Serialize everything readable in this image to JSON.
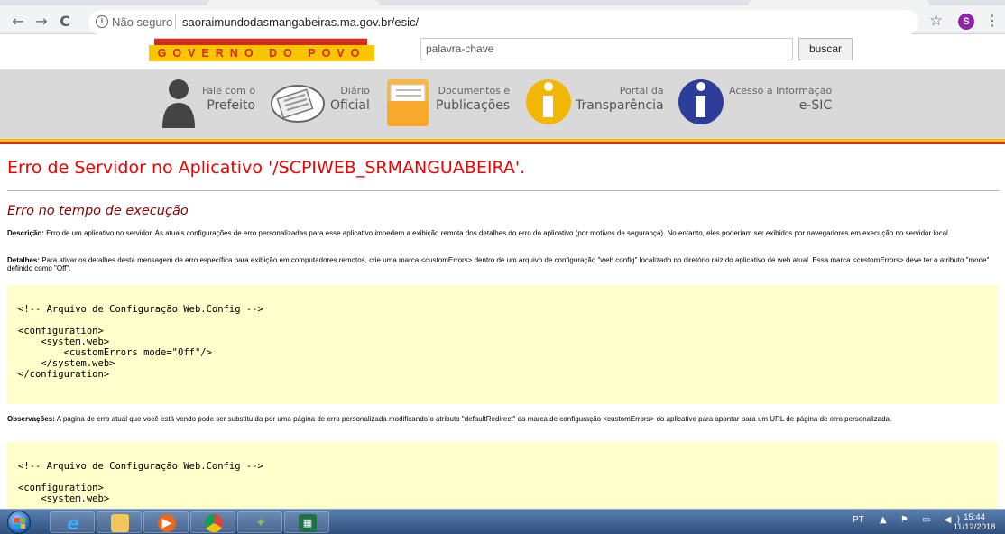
{
  "browser": {
    "back_icon": "←",
    "forward_icon": "→",
    "reload_icon": "C",
    "security_label": "Não seguro",
    "url": "saoraimundodasmangabeiras.ma.gov.br/esic/",
    "star_icon": "☆",
    "profile_initial": "S",
    "menu_icon": "⋮"
  },
  "header": {
    "logo_tagline": "GOVERNO DO POVO",
    "search_placeholder": "palavra-chave",
    "search_button": "buscar"
  },
  "nav": {
    "items": [
      {
        "line1": "Fale com o",
        "line2": "Prefeito",
        "icon": "person-icon"
      },
      {
        "line1": "Diário",
        "line2": "Oficial",
        "icon": "document-icon"
      },
      {
        "line1": "Documentos e",
        "line2": "Publicações",
        "icon": "folder-icon"
      },
      {
        "line1": "Portal da",
        "line2": "Transparência",
        "icon": "info-icon"
      },
      {
        "line1": "Acesso a Informação",
        "line2": "e-SIC",
        "icon": "info-icon"
      }
    ]
  },
  "error": {
    "title": "Erro de Servidor no Aplicativo '/SCPIWEB_SRMANGUABEIRA'.",
    "subtitle": "Erro no tempo de execução",
    "desc_label": "Descrição:",
    "desc_text": " Erro de um aplicativo no servidor. As atuais configurações de erro personalizadas para esse aplicativo impedem a exibição remota dos detalhes do erro do aplicativo (por motivos de segurança). No entanto, eles poderiam ser exibidos por navegadores em execução no servidor local.",
    "details_label": "Detalhes:",
    "details_text": " Para ativar os detalhes desta mensagem de erro específica para exibição em computadores remotos, crie uma marca <customErrors> dentro de um arquivo de configuração \"web.config\" localizado no diretório raiz do aplicativo de web atual. Essa marca <customErrors> deve ter o atributo \"mode\" definido como \"Off\".",
    "code1": "\n<!-- Arquivo de Configuração Web.Config -->\n\n<configuration>\n    <system.web>\n        <customErrors mode=\"Off\"/>\n    </system.web>\n</configuration>\n",
    "obs_label": "Observações:",
    "obs_text": " A página de erro atual que você está vendo pode ser substituída por uma página de erro personalizada modificando o atributo \"defaultRedirect\" da marca de configuração <customErrors> do aplicativo para apontar para um URL de página de erro personalizada.",
    "code2": "\n<!-- Arquivo de Configuração Web.Config -->\n\n<configuration>\n    <system.web>"
  },
  "taskbar": {
    "apps": [
      "internet-explorer",
      "file-explorer",
      "media-player",
      "chrome",
      "app",
      "spreadsheet"
    ],
    "language": "PT",
    "tray_icons": "▲ ⚑ ▭ ◀)",
    "time": "15:44",
    "date": "11/12/2018"
  }
}
